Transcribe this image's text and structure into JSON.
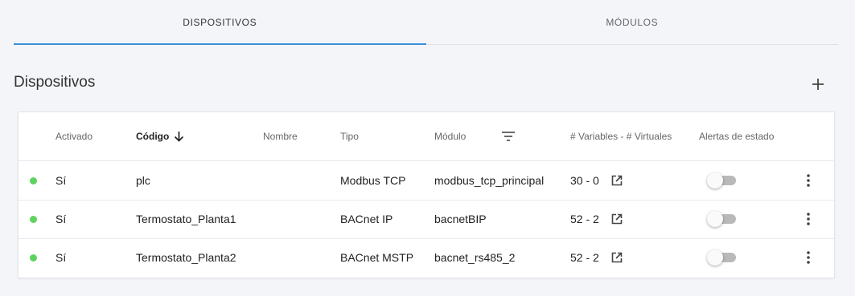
{
  "tabs": [
    {
      "label": "DISPOSITIVOS",
      "active": true
    },
    {
      "label": "MÓDULOS",
      "active": false
    }
  ],
  "section": {
    "title": "Dispositivos"
  },
  "colors": {
    "accent": "#3a8fd9",
    "status_active": "#5fd35f",
    "toggle_off": "#b9b9b9"
  },
  "table": {
    "headers": {
      "activado": "Activado",
      "codigo": "Código",
      "nombre": "Nombre",
      "tipo": "Tipo",
      "modulo": "Módulo",
      "variables": "# Variables - # Virtuales",
      "alertas": "Alertas de estado"
    },
    "sort": {
      "column": "codigo",
      "direction": "descending-arrow"
    },
    "rows": [
      {
        "status": "active",
        "activado": "Sí",
        "codigo": "plc",
        "nombre": "",
        "tipo": "Modbus TCP",
        "modulo": "modbus_tcp_principal",
        "variables": "30 - 0",
        "alertas": false
      },
      {
        "status": "active",
        "activado": "Sí",
        "codigo": "Termostato_Planta1",
        "nombre": "",
        "tipo": "BACnet IP",
        "modulo": "bacnetBIP",
        "variables": "52 - 2",
        "alertas": false
      },
      {
        "status": "active",
        "activado": "Sí",
        "codigo": "Termostato_Planta2",
        "nombre": "",
        "tipo": "BACnet MSTP",
        "modulo": "bacnet_rs485_2",
        "variables": "52 - 2",
        "alertas": false
      }
    ]
  },
  "icons": {
    "add": "plus-icon",
    "sort": "arrow-down-icon",
    "filter": "filter-icon",
    "open": "open-in-new-icon",
    "menu": "more-vert-icon"
  }
}
